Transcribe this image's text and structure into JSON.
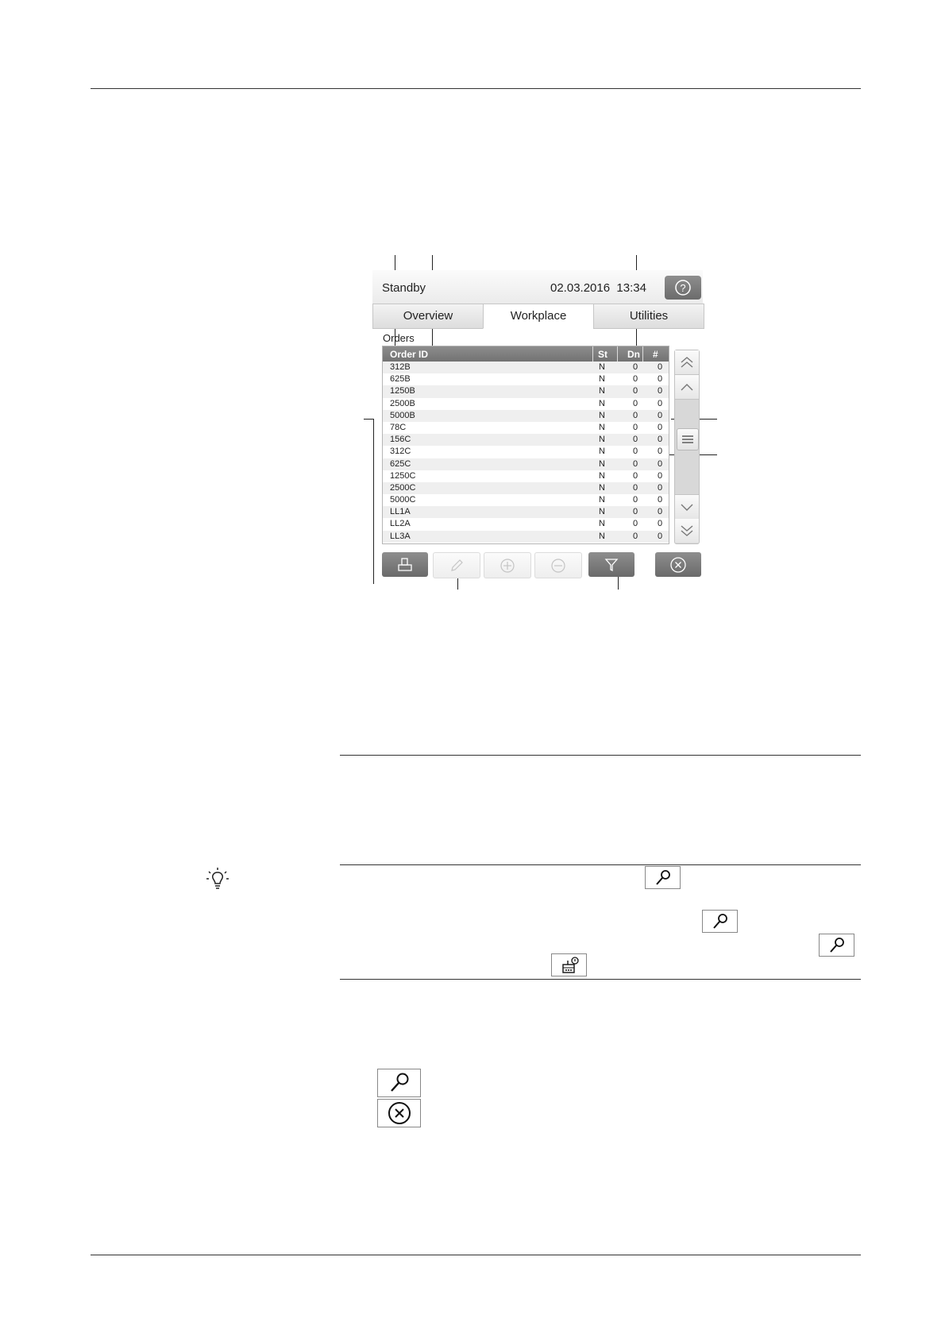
{
  "device": {
    "status": "Standby",
    "datetime": "02.03.2016  13:34",
    "tabs": [
      {
        "label": "Overview",
        "active": false
      },
      {
        "label": "Workplace",
        "active": true
      },
      {
        "label": "Utilities",
        "active": false
      }
    ],
    "orders_label": "Orders",
    "columns": {
      "order_id": "Order ID",
      "st": "St",
      "dn": "Dn",
      "count": "#"
    },
    "rows": [
      {
        "id": "312B",
        "st": "N",
        "dn": "0",
        "n": "0"
      },
      {
        "id": "625B",
        "st": "N",
        "dn": "0",
        "n": "0"
      },
      {
        "id": "1250B",
        "st": "N",
        "dn": "0",
        "n": "0"
      },
      {
        "id": "2500B",
        "st": "N",
        "dn": "0",
        "n": "0"
      },
      {
        "id": "5000B",
        "st": "N",
        "dn": "0",
        "n": "0"
      },
      {
        "id": "78C",
        "st": "N",
        "dn": "0",
        "n": "0"
      },
      {
        "id": "156C",
        "st": "N",
        "dn": "0",
        "n": "0"
      },
      {
        "id": "312C",
        "st": "N",
        "dn": "0",
        "n": "0"
      },
      {
        "id": "625C",
        "st": "N",
        "dn": "0",
        "n": "0"
      },
      {
        "id": "1250C",
        "st": "N",
        "dn": "0",
        "n": "0"
      },
      {
        "id": "2500C",
        "st": "N",
        "dn": "0",
        "n": "0"
      },
      {
        "id": "5000C",
        "st": "N",
        "dn": "0",
        "n": "0"
      },
      {
        "id": "LL1A",
        "st": "N",
        "dn": "0",
        "n": "0"
      },
      {
        "id": "LL2A",
        "st": "N",
        "dn": "0",
        "n": "0"
      },
      {
        "id": "LL3A",
        "st": "N",
        "dn": "0",
        "n": "0"
      }
    ],
    "toolbar": [
      {
        "name": "print-button",
        "icon": "print-icon",
        "enabled": true
      },
      {
        "name": "edit-button",
        "icon": "pencil-icon",
        "enabled": false
      },
      {
        "name": "add-button",
        "icon": "plus-circle-icon",
        "enabled": false
      },
      {
        "name": "remove-button",
        "icon": "minus-circle-icon",
        "enabled": false
      },
      {
        "name": "filter-button",
        "icon": "filter-icon",
        "enabled": true
      },
      {
        "name": "close-button",
        "icon": "close-circle-icon",
        "enabled": true
      }
    ]
  },
  "colors": {
    "button_dark": "#7a7a7a",
    "header_gray": "#808080",
    "row_stripe": "#efefef"
  }
}
